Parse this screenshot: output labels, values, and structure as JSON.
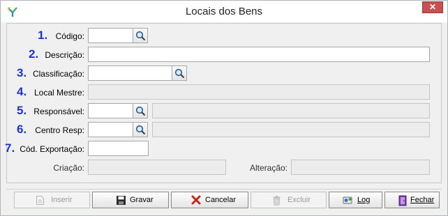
{
  "window": {
    "title": "Locais dos Bens",
    "close_symbol": "✕"
  },
  "form": {
    "codigo": {
      "number": "1.",
      "label": "Código:",
      "value": ""
    },
    "descricao": {
      "number": "2.",
      "label": "Descrição:",
      "value": ""
    },
    "classificacao": {
      "number": "3.",
      "label": "Classificação:",
      "value": ""
    },
    "local_mestre": {
      "number": "4.",
      "label": "Local Mestre:",
      "value": ""
    },
    "responsavel": {
      "number": "5.",
      "label": "Responsável:",
      "value": "",
      "description": ""
    },
    "centro_resp": {
      "number": "6.",
      "label": "Centro Resp:",
      "value": "",
      "description": ""
    },
    "cod_exportacao": {
      "number": "7.",
      "label": "Cód. Exportação:",
      "value": ""
    },
    "criacao": {
      "label": "Criação:",
      "value": ""
    },
    "alteracao": {
      "label": "Alteração:",
      "value": ""
    }
  },
  "buttons": {
    "inserir": "Inserir",
    "gravar": "Gravar",
    "cancelar": "Cancelar",
    "excluir": "Excluir",
    "log": "Log",
    "fechar": "Fechar"
  },
  "colors": {
    "number_accent": "#1b35c9",
    "close_button": "#c75050"
  }
}
